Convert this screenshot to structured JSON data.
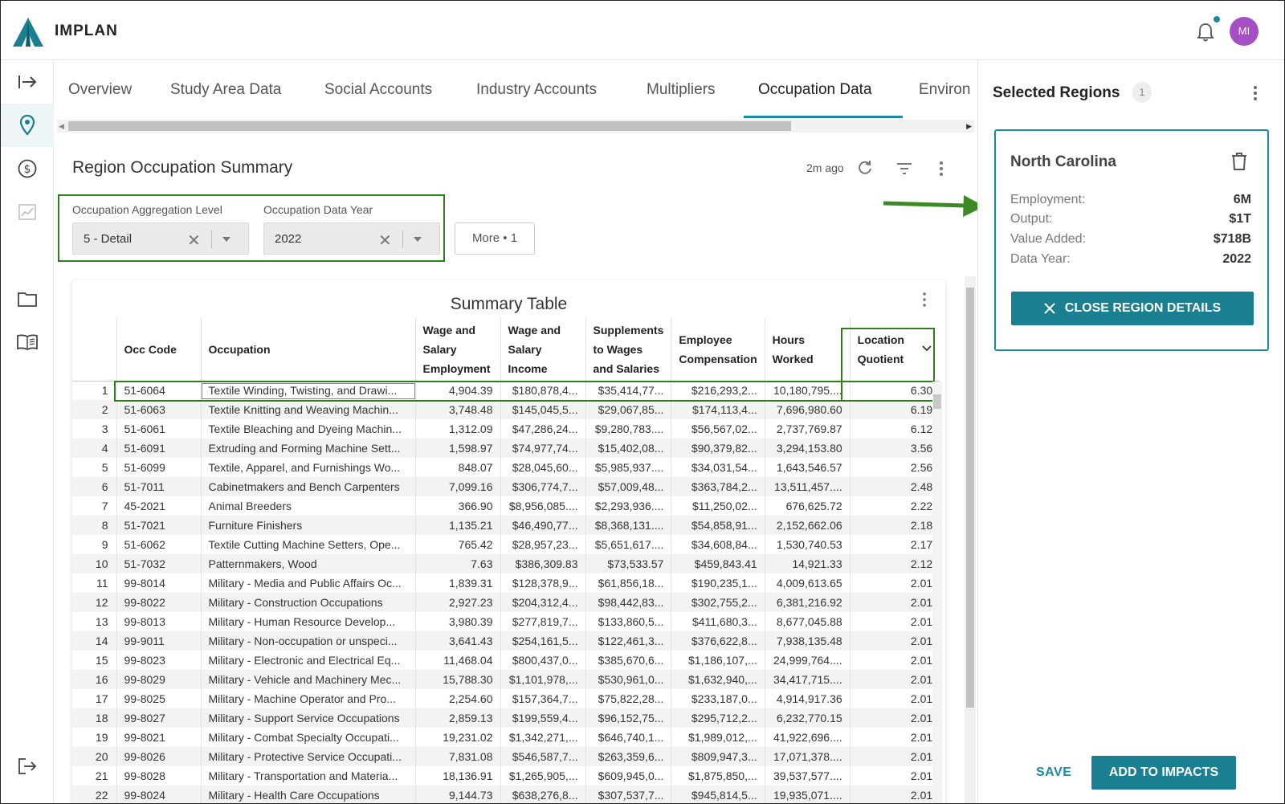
{
  "app": {
    "brand": "IMPLAN",
    "user_initials": "MI"
  },
  "colors": {
    "accent": "#1a7f90",
    "highlight": "#2e7d1f",
    "avatar": "#a54fc2"
  },
  "rail": {
    "items": [
      {
        "icon": "expand-arrow-icon"
      },
      {
        "icon": "location-pin-icon",
        "active": true
      },
      {
        "icon": "dollar-circle-icon"
      },
      {
        "icon": "chart-icon"
      },
      {
        "icon": "folder-icon"
      },
      {
        "icon": "book-icon"
      },
      {
        "icon": "logout-icon"
      }
    ]
  },
  "tabs": [
    {
      "label": "Overview"
    },
    {
      "label": "Study Area Data"
    },
    {
      "label": "Social Accounts"
    },
    {
      "label": "Industry Accounts"
    },
    {
      "label": "Multipliers"
    },
    {
      "label": "Occupation Data",
      "active": true
    },
    {
      "label": "Environ"
    }
  ],
  "summary": {
    "title": "Region Occupation Summary",
    "updated": "2m ago",
    "aggregation_label": "Occupation Aggregation Level",
    "aggregation_value": "5 - Detail",
    "year_label": "Occupation Data Year",
    "year_value": "2022",
    "more_label": "More • 1"
  },
  "table": {
    "title": "Summary Table",
    "headers": {
      "occ_code": "Occ Code",
      "occupation": "Occupation",
      "wse": [
        "Wage and",
        "Salary",
        "Employment"
      ],
      "wsi": [
        "Wage and",
        "Salary",
        "Income"
      ],
      "sup": [
        "Supplements",
        "to Wages",
        "and Salaries"
      ],
      "ec": [
        "Employee",
        "Compensation"
      ],
      "hw": [
        "Hours",
        "Worked"
      ],
      "lq": [
        "Location",
        "Quotient"
      ]
    },
    "rows": [
      [
        "1",
        "51-6064",
        "Textile Winding, Twisting, and Drawi...",
        "4,904.39",
        "$180,878,4...",
        "$35,414,77...",
        "$216,293,2...",
        "10,180,795....",
        "6.30"
      ],
      [
        "2",
        "51-6063",
        "Textile Knitting and Weaving Machin...",
        "3,748.48",
        "$145,045,5...",
        "$29,067,85...",
        "$174,113,4...",
        "7,696,980.60",
        "6.19"
      ],
      [
        "3",
        "51-6061",
        "Textile Bleaching and Dyeing Machin...",
        "1,312.09",
        "$47,286,24...",
        "$9,280,783....",
        "$56,567,02...",
        "2,737,769.87",
        "6.12"
      ],
      [
        "4",
        "51-6091",
        "Extruding and Forming Machine Sett...",
        "1,598.97",
        "$74,977,74...",
        "$15,402,08...",
        "$90,379,82...",
        "3,294,153.80",
        "3.56"
      ],
      [
        "5",
        "51-6099",
        "Textile, Apparel, and Furnishings Wo...",
        "848.07",
        "$28,045,60...",
        "$5,985,937....",
        "$34,031,54...",
        "1,643,546.57",
        "2.56"
      ],
      [
        "6",
        "51-7011",
        "Cabinetmakers and Bench Carpenters",
        "7,099.16",
        "$306,774,7...",
        "$57,009,48...",
        "$363,784,2...",
        "13,511,457....",
        "2.48"
      ],
      [
        "7",
        "45-2021",
        "Animal Breeders",
        "366.90",
        "$8,956,085....",
        "$2,293,936....",
        "$11,250,02...",
        "676,625.72",
        "2.22"
      ],
      [
        "8",
        "51-7021",
        "Furniture Finishers",
        "1,135.21",
        "$46,490,77...",
        "$8,368,131....",
        "$54,858,91...",
        "2,152,662.06",
        "2.18"
      ],
      [
        "9",
        "51-6062",
        "Textile Cutting Machine Setters, Ope...",
        "765.42",
        "$28,957,23...",
        "$5,651,617....",
        "$34,608,84...",
        "1,530,740.53",
        "2.17"
      ],
      [
        "10",
        "51-7032",
        "Patternmakers, Wood",
        "7.63",
        "$386,309.83",
        "$73,533.57",
        "$459,843.41",
        "14,921.33",
        "2.12"
      ],
      [
        "11",
        "99-8014",
        "Military - Media and Public Affairs Oc...",
        "1,839.31",
        "$128,378,9...",
        "$61,856,18...",
        "$190,235,1...",
        "4,009,613.65",
        "2.01"
      ],
      [
        "12",
        "99-8022",
        "Military - Construction  Occupations",
        "2,927.23",
        "$204,312,4...",
        "$98,442,83...",
        "$302,755,2...",
        "6,381,216.92",
        "2.01"
      ],
      [
        "13",
        "99-8013",
        "Military - Human Resource Develop...",
        "3,980.39",
        "$277,819,7...",
        "$133,860,5...",
        "$411,680,3...",
        "8,677,045.88",
        "2.01"
      ],
      [
        "14",
        "99-9011",
        "Military - Non-occupation or unspeci...",
        "3,641.43",
        "$254,161,5...",
        "$122,461,3...",
        "$376,622,8...",
        "7,938,135.48",
        "2.01"
      ],
      [
        "15",
        "99-8023",
        "Military - Electronic and Electrical Eq...",
        "11,468.04",
        "$800,437,0...",
        "$385,670,6...",
        "$1,186,107,...",
        "24,999,764....",
        "2.01"
      ],
      [
        "16",
        "99-8029",
        "Military - Vehicle and Machinery Mec...",
        "15,788.30",
        "$1,101,978,...",
        "$530,961,0...",
        "$1,632,940,...",
        "34,417,715....",
        "2.01"
      ],
      [
        "17",
        "99-8025",
        "Military - Machine Operator and Pro...",
        "2,254.60",
        "$157,364,7...",
        "$75,822,28...",
        "$233,187,0...",
        "4,914,917.36",
        "2.01"
      ],
      [
        "18",
        "99-8027",
        "Military - Support Service Occupations",
        "2,859.13",
        "$199,559,4...",
        "$96,152,75...",
        "$295,712,2...",
        "6,232,770.15",
        "2.01"
      ],
      [
        "19",
        "99-8021",
        "Military - Combat Specialty  Occupati...",
        "19,231.02",
        "$1,342,271,...",
        "$646,740,1...",
        "$1,989,012,...",
        "41,922,696....",
        "2.01"
      ],
      [
        "20",
        "99-8026",
        "Military - Protective Service Occupati...",
        "7,831.08",
        "$546,587,7...",
        "$263,359,6...",
        "$809,947,3...",
        "17,071,378....",
        "2.01"
      ],
      [
        "21",
        "99-8028",
        "Military - Transportation and Materia...",
        "18,136.91",
        "$1,265,905,...",
        "$609,945,0...",
        "$1,875,850,...",
        "39,537,577....",
        "2.01"
      ],
      [
        "22",
        "99-8024",
        "Military - Health Care Occupations",
        "9,144.73",
        "$638,276,8...",
        "$307,537,7...",
        "$945,814,5...",
        "19,935,071....",
        "2.01"
      ]
    ]
  },
  "right_panel": {
    "title": "Selected Regions",
    "count": "1",
    "region": {
      "name": "North Carolina",
      "employment_label": "Employment:",
      "employment_value": "6M",
      "output_label": "Output:",
      "output_value": "$1T",
      "value_added_label": "Value Added:",
      "value_added_value": "$718B",
      "data_year_label": "Data Year:",
      "data_year_value": "2022"
    },
    "close_label": "CLOSE REGION DETAILS",
    "save_label": "SAVE",
    "add_label": "ADD TO IMPACTS"
  }
}
